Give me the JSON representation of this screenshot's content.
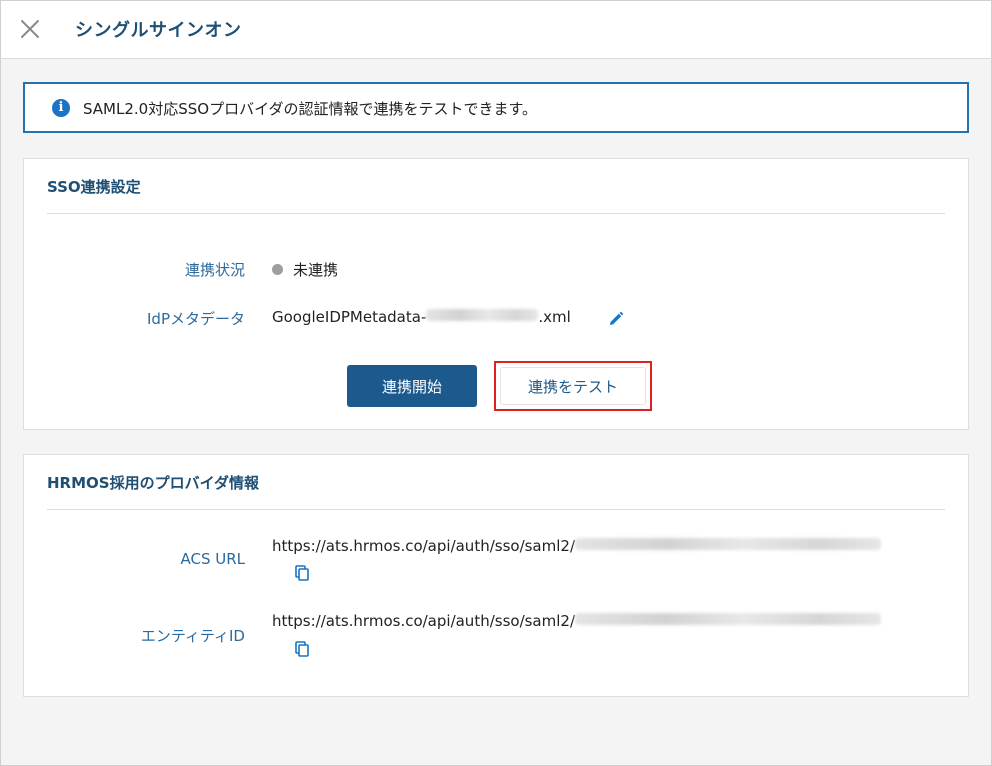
{
  "header": {
    "title": "シングルサインオン",
    "close_icon": "close-icon"
  },
  "banner": {
    "icon": "info-icon",
    "icon_glyph": "i",
    "text": "SAML2.0対応SSOプロバイダの認証情報で連携をテストできます。"
  },
  "sso_settings": {
    "title": "SSO連携設定",
    "status_label": "連携状況",
    "status_value": "未連携",
    "status_color": "#9e9e9e",
    "metadata_label": "IdPメタデータ",
    "metadata_prefix": "GoogleIDPMetadata-",
    "metadata_suffix": ".xml",
    "edit_icon": "pencil-icon",
    "start_button": "連携開始",
    "test_button": "連携をテスト"
  },
  "hrmos_info": {
    "title": "HRMOS採用のプロバイダ情報",
    "acs_label": "ACS URL",
    "acs_value": "https://ats.hrmos.co/api/auth/sso/saml2/",
    "entity_label": "エンティティID",
    "entity_value": "https://ats.hrmos.co/api/auth/sso/saml2/",
    "copy_icon": "copy-icon"
  },
  "colors": {
    "accent": "#1c5a8e",
    "banner_border": "#2472b0",
    "highlight": "#e0201f"
  }
}
